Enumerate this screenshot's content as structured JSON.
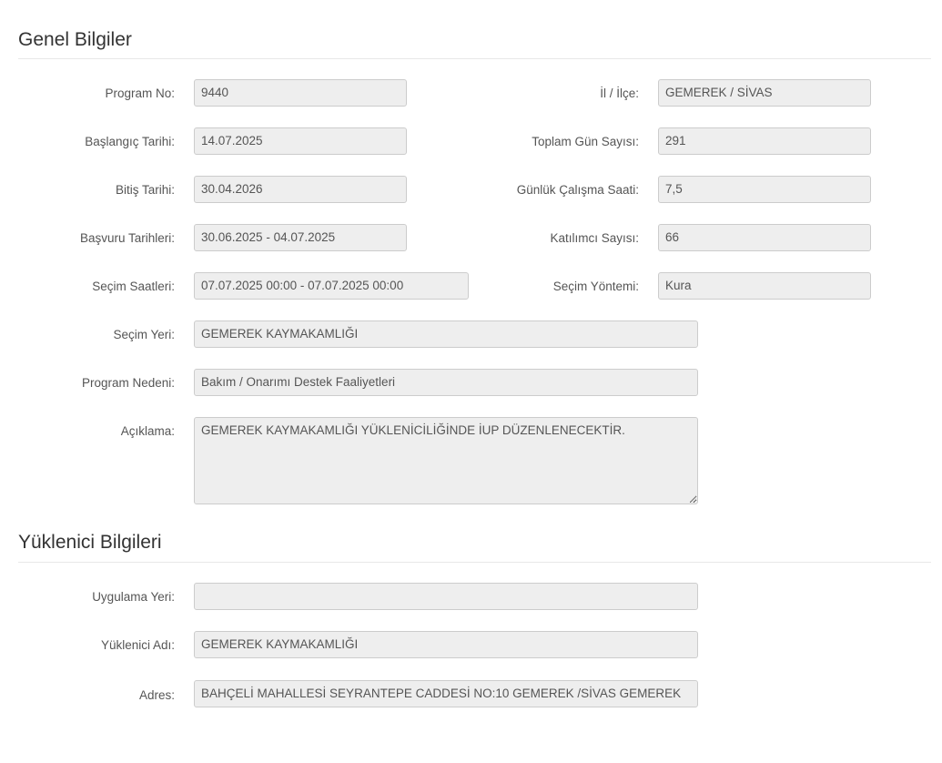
{
  "general": {
    "title": "Genel Bilgiler",
    "program_no": {
      "label": "Program No:",
      "value": "9440"
    },
    "il_ilce": {
      "label": "İl / İlçe:",
      "value": "GEMEREK / SİVAS"
    },
    "baslangic": {
      "label": "Başlangıç Tarihi:",
      "value": "14.07.2025"
    },
    "toplam_gun": {
      "label": "Toplam Gün Sayısı:",
      "value": "291"
    },
    "bitis": {
      "label": "Bitiş Tarihi:",
      "value": "30.04.2026"
    },
    "gunluk_saat": {
      "label": "Günlük Çalışma Saati:",
      "value": "7,5"
    },
    "basvuru": {
      "label": "Başvuru Tarihleri:",
      "value": "30.06.2025 - 04.07.2025"
    },
    "katilimci": {
      "label": "Katılımcı Sayısı:",
      "value": "66"
    },
    "secim_saatleri": {
      "label": "Seçim Saatleri:",
      "value": "07.07.2025 00:00 - 07.07.2025 00:00"
    },
    "secim_yontemi": {
      "label": "Seçim Yöntemi:",
      "value": "Kura"
    },
    "secim_yeri": {
      "label": "Seçim Yeri:",
      "value": "GEMEREK KAYMAKAMLIĞI"
    },
    "program_nedeni": {
      "label": "Program Nedeni:",
      "value": "Bakım / Onarımı Destek Faaliyetleri"
    },
    "aciklama": {
      "label": "Açıklama:",
      "value": "GEMEREK KAYMAKAMLIĞI YÜKLENİCİLİĞİNDE İUP DÜZENLENECEKTİR."
    }
  },
  "contractor": {
    "title": "Yüklenici Bilgileri",
    "uygulama_yeri": {
      "label": "Uygulama Yeri:",
      "value": ""
    },
    "yuklenici_adi": {
      "label": "Yüklenici Adı:",
      "value": "GEMEREK KAYMAKAMLIĞI"
    },
    "adres": {
      "label": "Adres:",
      "value": "BAHÇELİ MAHALLESİ SEYRANTEPE CADDESİ NO:10 GEMEREK /SİVAS  GEMEREK"
    }
  }
}
